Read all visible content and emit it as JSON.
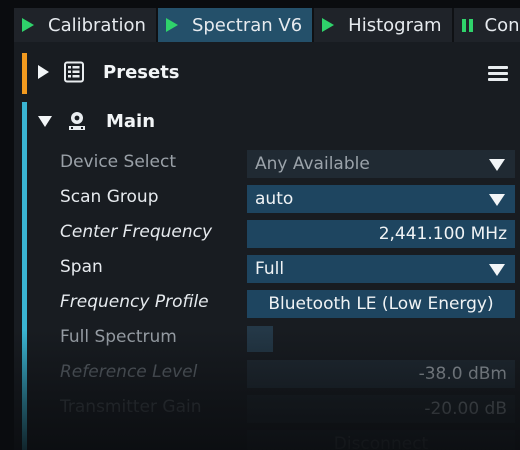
{
  "tabs": [
    {
      "label": "Calibration",
      "icon": "play-icon",
      "active": false
    },
    {
      "label": "Spectran V6",
      "icon": "play-icon",
      "active": true
    },
    {
      "label": "Histogram",
      "icon": "play-icon",
      "active": false
    },
    {
      "label": "Con",
      "icon": "pause-icon",
      "active": false
    }
  ],
  "presets": {
    "title": "Presets",
    "icon": "document-list-icon",
    "menu_icon": "hamburger-menu-icon",
    "accent": "#f29a1f"
  },
  "main": {
    "title": "Main",
    "icon": "device-icon",
    "accent": "#3ab4d2",
    "rows": [
      {
        "label": "Device Select",
        "value": "Any Available"
      },
      {
        "label": "Scan Group",
        "value": "auto"
      },
      {
        "label": "Center Frequency",
        "value": "2,441.100 MHz"
      },
      {
        "label": "Span",
        "value": "Full"
      },
      {
        "label": "Frequency Profile",
        "value": "Bluetooth LE (Low Energy)"
      },
      {
        "label": "Full Spectrum",
        "value": ""
      },
      {
        "label": "Reference Level",
        "value": "-38.0 dBm"
      },
      {
        "label": "Transmitter Gain",
        "value": "-20.00 dB"
      }
    ],
    "disconnect_label": "Disconnect"
  },
  "colors": {
    "field": "#1e4560",
    "active_tab": "#24506a",
    "play_icon": "#2fd36b"
  }
}
